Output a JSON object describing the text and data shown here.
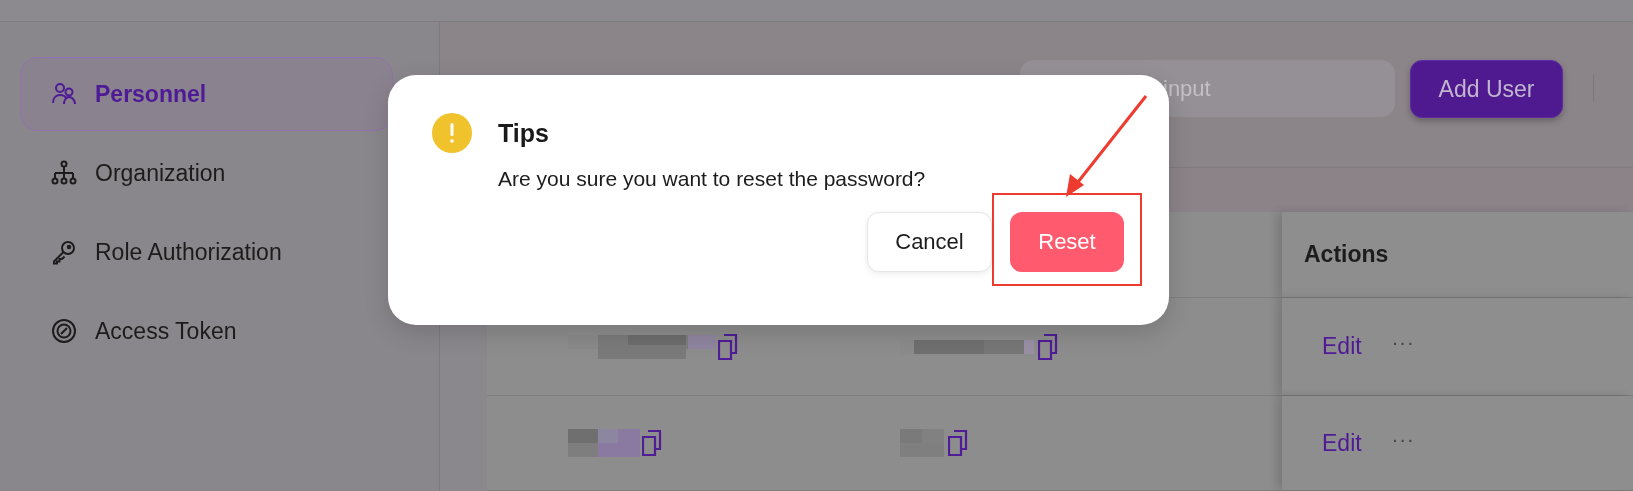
{
  "sidebar": {
    "items": [
      {
        "label": "Personnel",
        "selected": true
      },
      {
        "label": "Organization",
        "selected": false
      },
      {
        "label": "Role Authorization",
        "selected": false
      },
      {
        "label": "Access Token",
        "selected": false
      }
    ]
  },
  "toolbar": {
    "search": {
      "placeholder": "input"
    },
    "add_button": "Add User"
  },
  "table": {
    "columns": [
      {
        "label": "Actions"
      }
    ],
    "rows": [
      {
        "kind": "long",
        "edit": "Edit",
        "more": "···"
      },
      {
        "kind": "short",
        "edit": "Edit",
        "more": "···"
      }
    ]
  },
  "dialog": {
    "title": "Tips",
    "message": "Are you sure you want to reset the password?",
    "buttons": [
      {
        "label": "Cancel",
        "kind": "secondary",
        "annotated": false
      },
      {
        "label": "Reset",
        "kind": "danger",
        "annotated": true
      }
    ]
  }
}
